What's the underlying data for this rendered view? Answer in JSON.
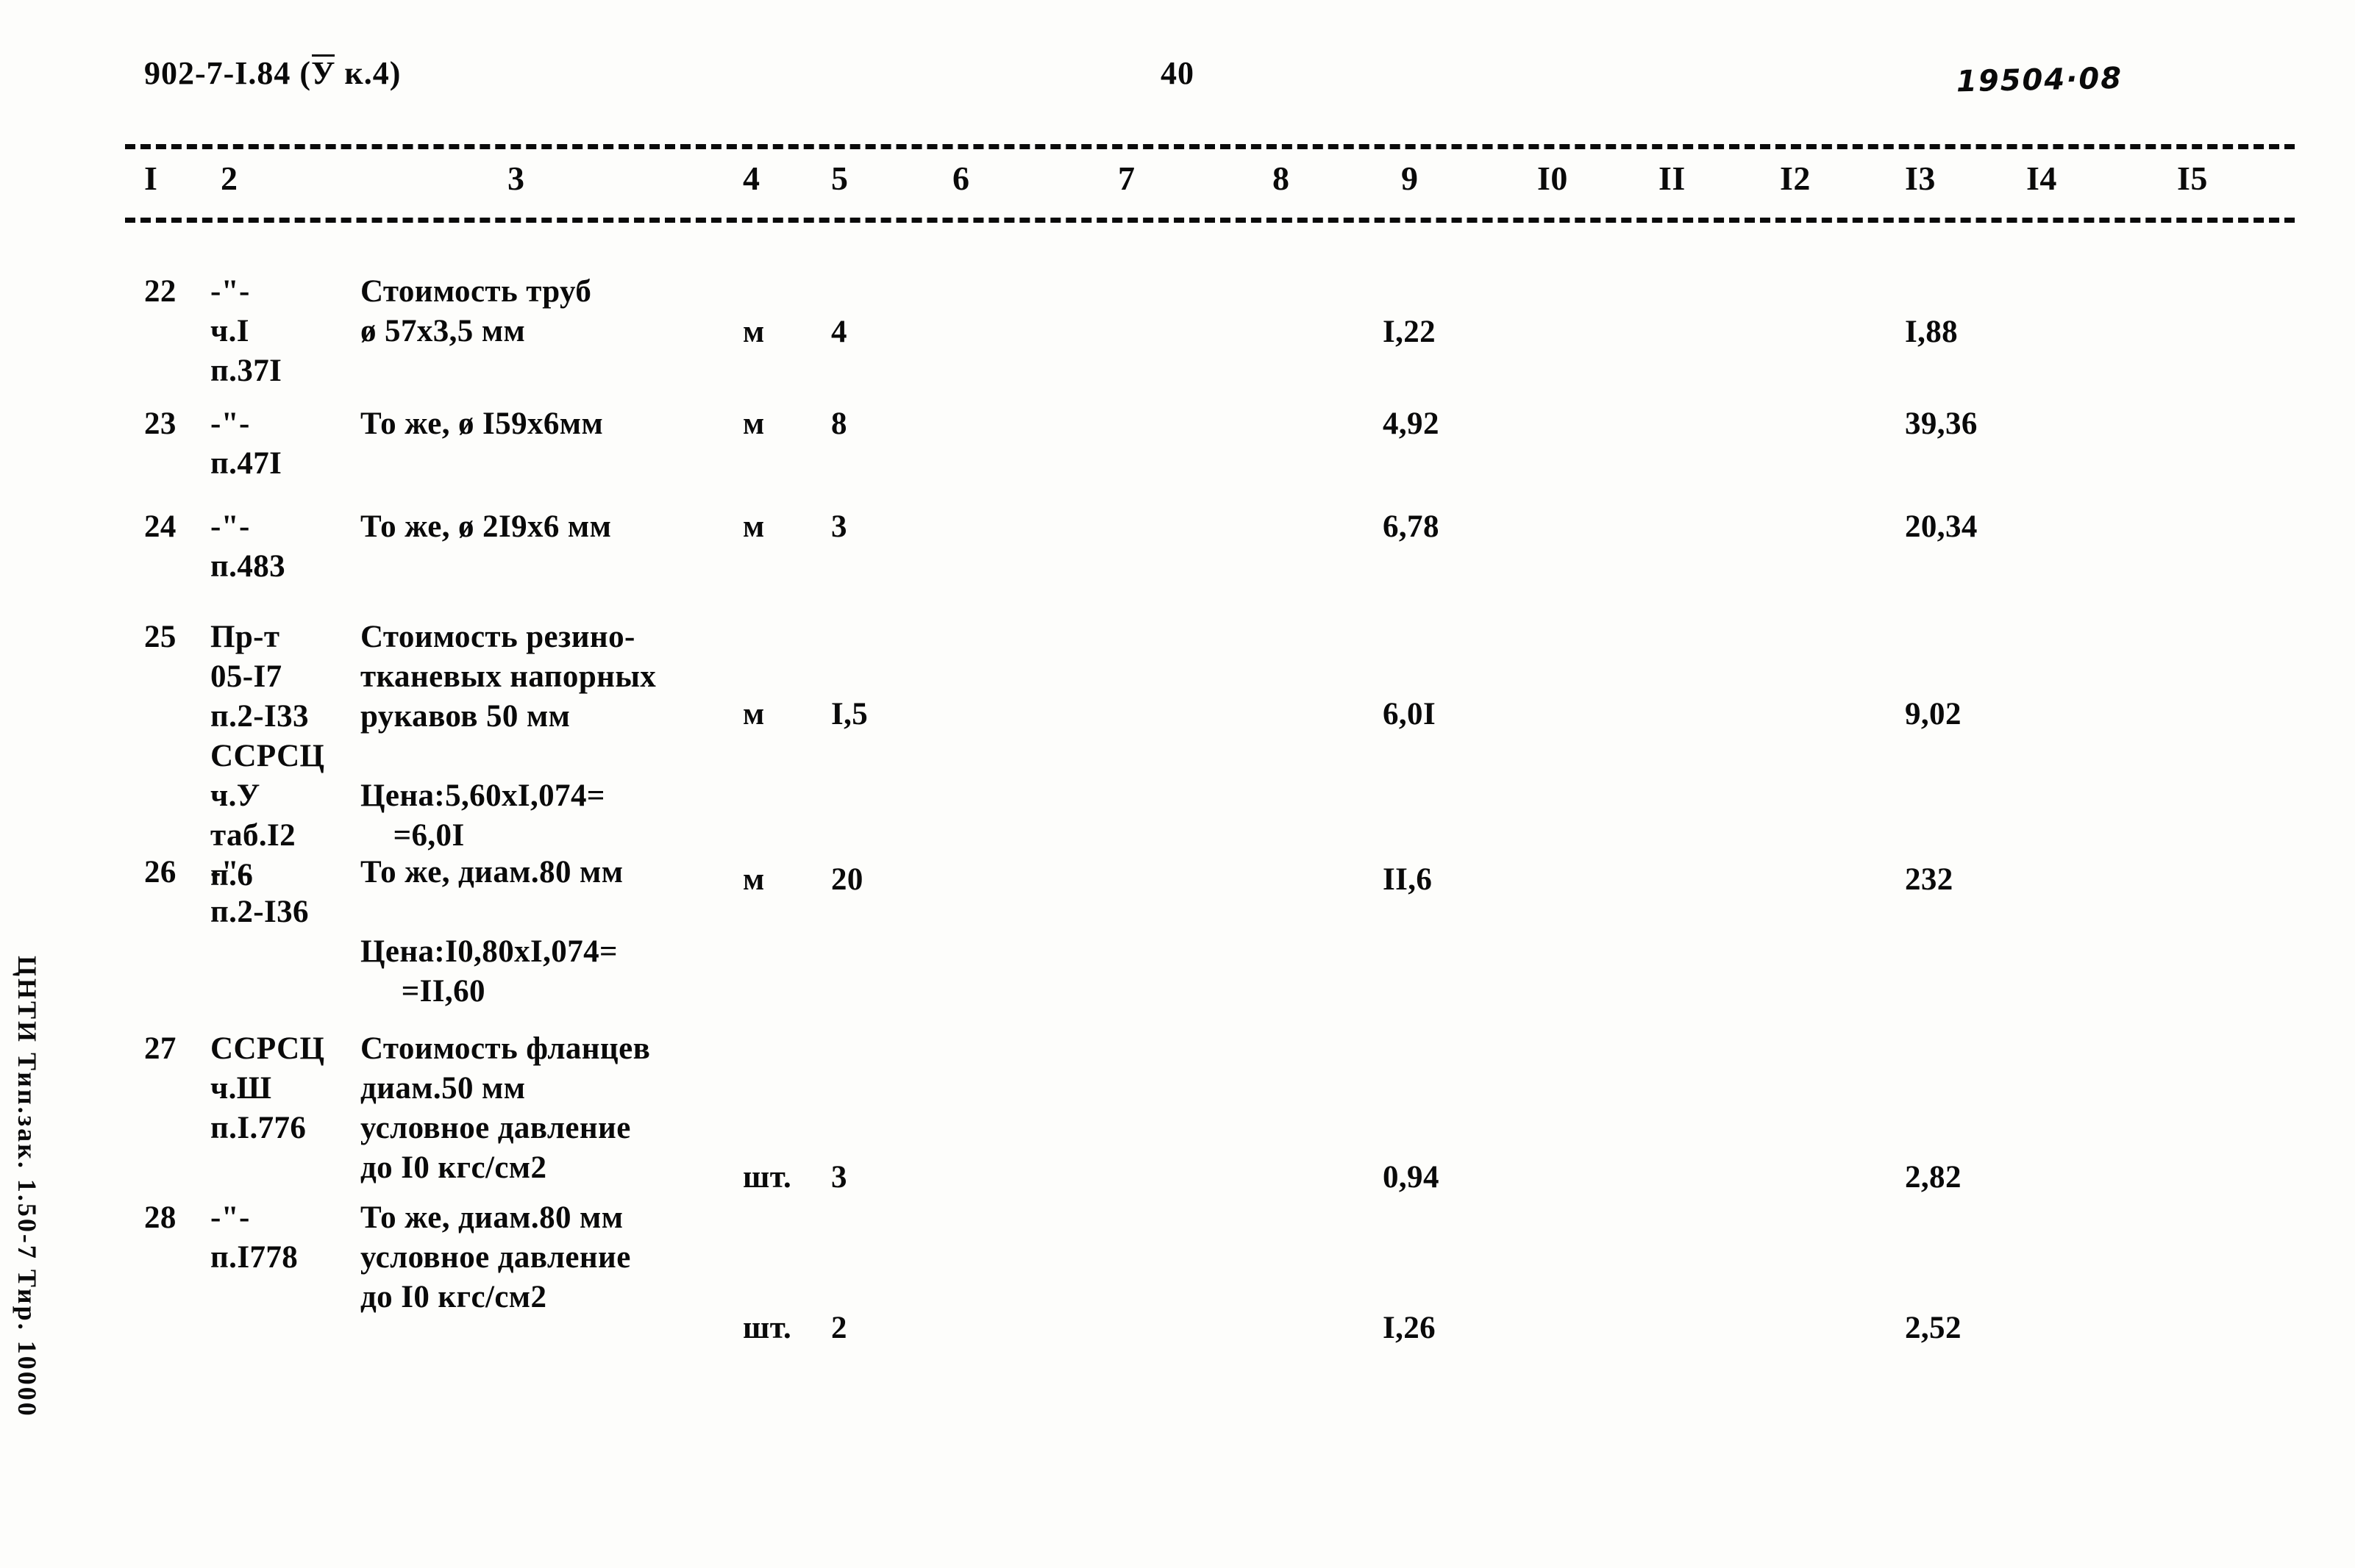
{
  "header": {
    "doc_code": "902-7-I.84 (",
    "doc_code_overline": "У",
    "doc_code_tail": " к.4)",
    "page_number": "40",
    "stamp_number": "19504·08"
  },
  "table": {
    "column_headers": [
      "I",
      "2",
      "3",
      "4",
      "5",
      "6",
      "7",
      "8",
      "9",
      "I0",
      "II",
      "I2",
      "I3",
      "I4",
      "I5"
    ],
    "rows": [
      {
        "num": "22",
        "justification": "-\"-\nч.I\nп.37I",
        "description": "Стоимость труб\nø 57х3,5 мм",
        "unit": "м",
        "quantity": "4",
        "col9": "I,22",
        "col13": "I,88"
      },
      {
        "num": "23",
        "justification": "-\"-\nп.47I",
        "description": "То же, ø I59х6мм",
        "unit": "м",
        "quantity": "8",
        "col9": "4,92",
        "col13": "39,36"
      },
      {
        "num": "24",
        "justification": "-\"-\nп.483",
        "description": "То же, ø 2I9х6 мм",
        "unit": "м",
        "quantity": "3",
        "col9": "6,78",
        "col13": "20,34"
      },
      {
        "num": "25",
        "justification": "Пр-т\n05-I7\nп.2-I33\nССРСЦ\nч.У\nтаб.I2\nп.6",
        "description": "Стоимость резино-\nтканевых напорных\nрукавов 50 мм\n\nЦена:5,60хI,074=\n    =6,0I",
        "unit": "м",
        "quantity": "I,5",
        "col9": "6,0I",
        "col13": "9,02"
      },
      {
        "num": "26",
        "justification": "-\"-\nп.2-I36",
        "description": "То же, диам.80 мм\n\nЦена:I0,80хI,074=\n     =II,60",
        "unit": "м",
        "quantity": "20",
        "col9": "II,6",
        "col13": "232"
      },
      {
        "num": "27",
        "justification": "ССРСЦ\nч.Ш\nп.I.776",
        "description": "Стоимость фланцев\nдиам.50 мм\nусловное давление\nдо I0 кгс/см2",
        "unit": "шт.",
        "quantity": "3",
        "col9": "0,94",
        "col13": "2,82"
      },
      {
        "num": "28",
        "justification": "-\"-\nп.I778",
        "description": "То же, диам.80 мм\nусловное давление\nдо I0 кгс/см2",
        "unit": "шт.",
        "quantity": "2",
        "col9": "I,26",
        "col13": "2,52"
      }
    ]
  },
  "imprint": "ЦНТИ Тип.зак. 1.50-7 Тир. 10000"
}
